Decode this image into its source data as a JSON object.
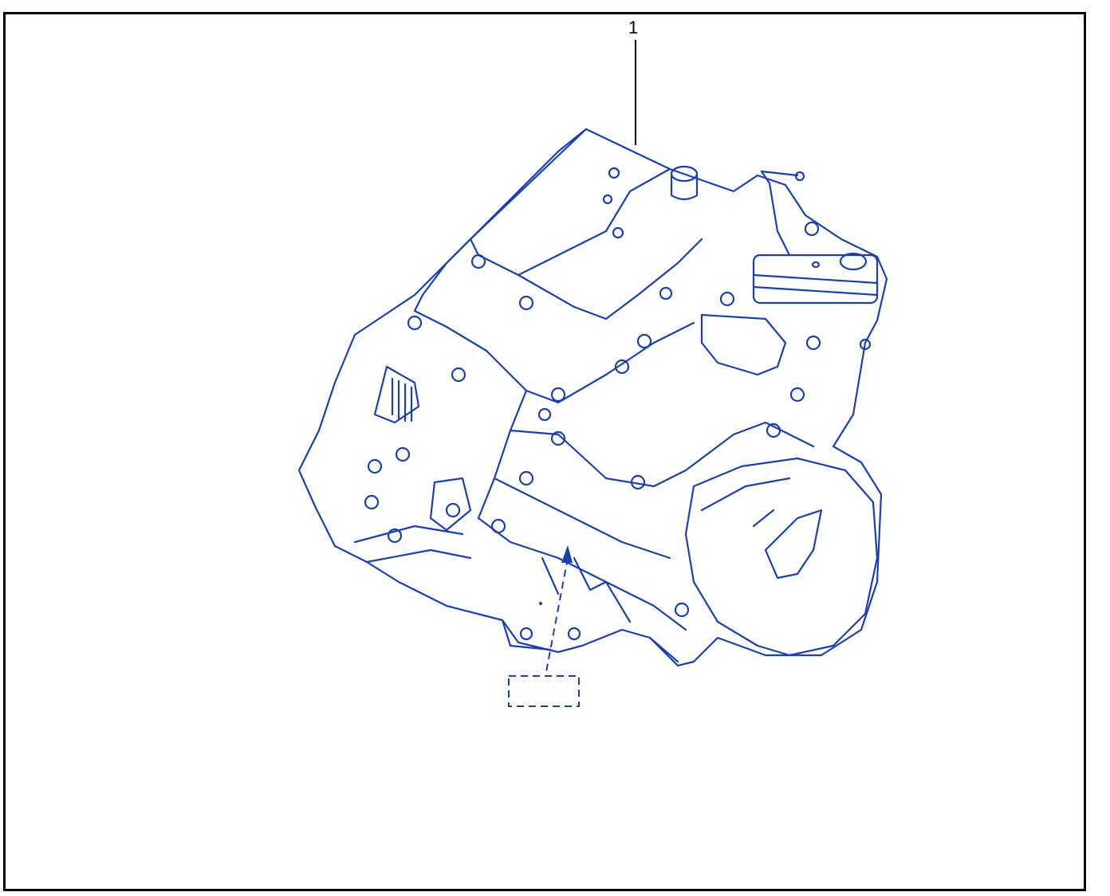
{
  "diagram": {
    "callouts": [
      {
        "label": "1"
      }
    ],
    "colors": {
      "line_art": "#1a3fb3",
      "leader": "#000000",
      "frame": "#000000",
      "background": "#ffffff"
    },
    "icons": {
      "part": "gearbox-assembly-icon",
      "marker": "identification-plate-arrow-icon"
    }
  }
}
